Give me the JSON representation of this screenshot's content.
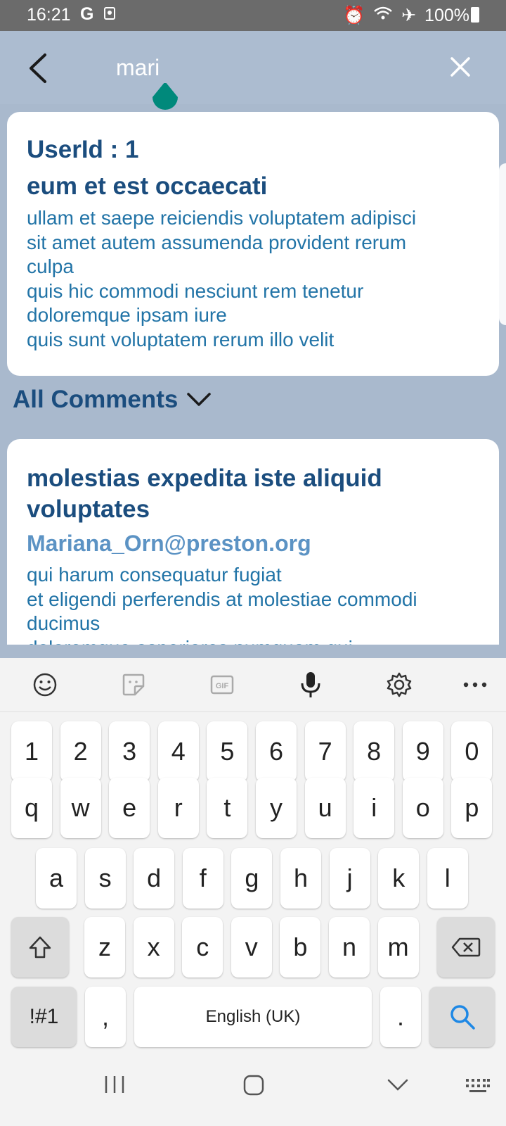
{
  "status": {
    "time": "16:21",
    "battery": "100%"
  },
  "search": {
    "query": "mari"
  },
  "post": {
    "user_label": "UserId : 1",
    "title": "eum et est occaecati",
    "body": "ullam et saepe reiciendis voluptatem adipisci\nsit amet autem assumenda provident rerum\nculpa\nquis hic commodi nesciunt rem tenetur\ndoloremque ipsam iure\nquis sunt voluptatem rerum illo velit"
  },
  "comments": {
    "header": "All Comments",
    "first": {
      "title": "molestias expedita iste aliquid voluptates",
      "email": "Mariana_Orn@preston.org",
      "body": "qui harum consequatur fugiat\net eligendi perferendis at molestiae commodi\nducimus\ndoloremque asperiores numquam qui"
    }
  },
  "keyboard": {
    "numbers": [
      "1",
      "2",
      "3",
      "4",
      "5",
      "6",
      "7",
      "8",
      "9",
      "0"
    ],
    "row1": [
      "q",
      "w",
      "e",
      "r",
      "t",
      "y",
      "u",
      "i",
      "o",
      "p"
    ],
    "row2": [
      "a",
      "s",
      "d",
      "f",
      "g",
      "h",
      "j",
      "k",
      "l"
    ],
    "row3": [
      "z",
      "x",
      "c",
      "v",
      "b",
      "n",
      "m"
    ],
    "symbols": "!#1",
    "comma": ",",
    "space": "English (UK)",
    "period": "."
  },
  "colors": {
    "accent": "#1b4d7e",
    "body_text": "#2274a7",
    "email": "#5c93c4",
    "background": "#a9b9cd",
    "handle": "#00897b"
  }
}
